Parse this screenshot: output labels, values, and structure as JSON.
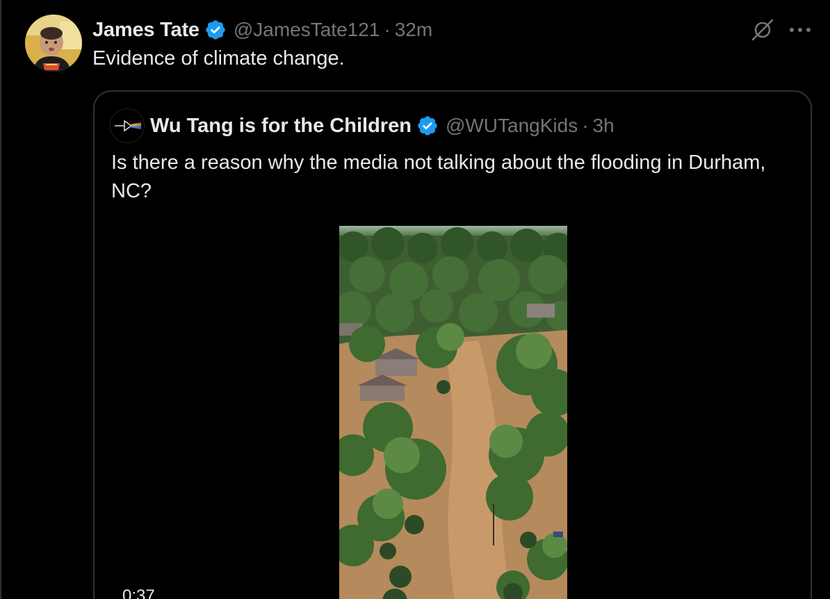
{
  "tweet": {
    "author_name": "James Tate",
    "handle": "@JamesTate121",
    "separator": "·",
    "time": "32m",
    "text": "Evidence of climate change.",
    "verified_badge_icon": "verified-badge-icon",
    "grok_icon": "grok-icon",
    "more_icon": "more-options-icon"
  },
  "quoted_tweet": {
    "author_name": "Wu Tang is for the Children",
    "handle": "@WUTangKids",
    "separator": "·",
    "time": "3h",
    "text": "Is there a reason why the media not talking about the flooding in Durham, NC?",
    "video_duration": "0:37"
  },
  "colors": {
    "background": "#000000",
    "text_primary": "#e7e9ea",
    "text_secondary": "#71767b",
    "border": "#2f3336",
    "verified_blue": "#1d9bf0"
  }
}
